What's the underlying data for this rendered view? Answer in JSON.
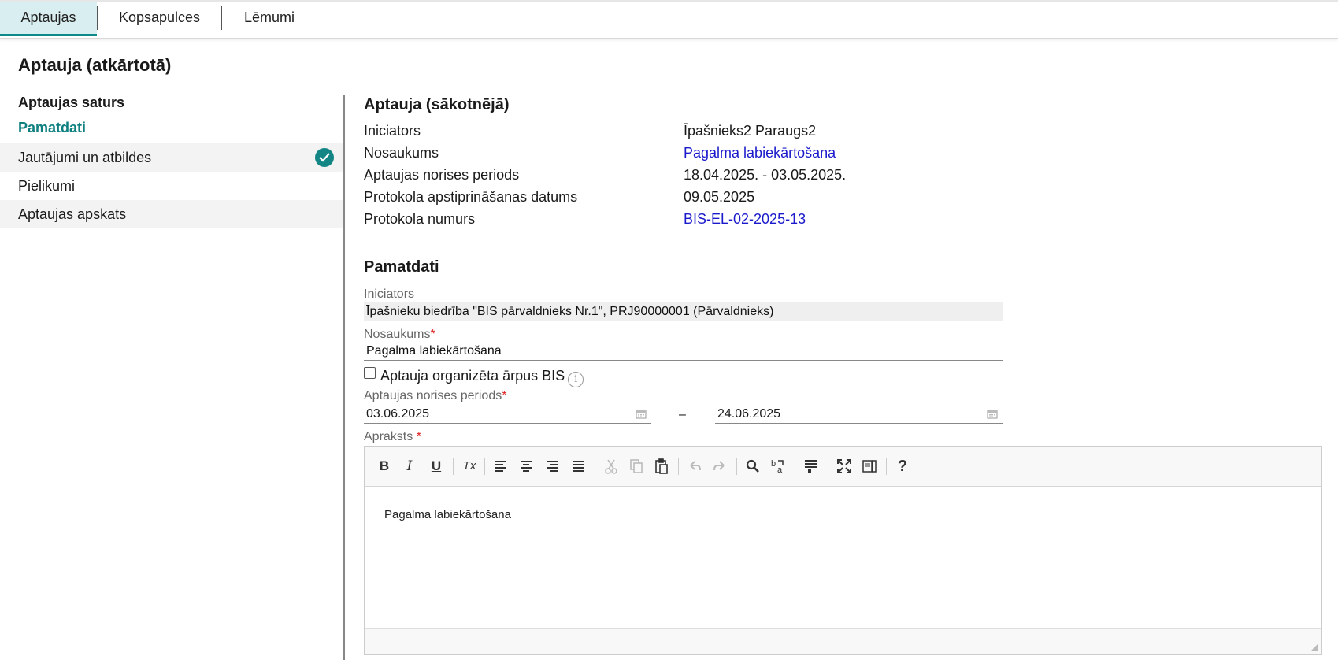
{
  "tabs": [
    "Aptaujas",
    "Kopsapulces",
    "Lēmumi"
  ],
  "page_title": "Aptauja (atkārtotā)",
  "sidebar": {
    "heading": "Aptaujas saturs",
    "items": [
      {
        "label": "Pamatdati"
      },
      {
        "label": "Jautājumi un atbildes"
      },
      {
        "label": "Pielikumi"
      },
      {
        "label": "Aptaujas apskats"
      }
    ]
  },
  "original": {
    "title": "Aptauja (sākotnējā)",
    "rows": [
      {
        "label": "Iniciators",
        "value": "Īpašnieks2 Paraugs2"
      },
      {
        "label": "Nosaukums",
        "value": "Pagalma labiekārtošana"
      },
      {
        "label": "Aptaujas norises periods",
        "value": "18.04.2025. - 03.05.2025."
      },
      {
        "label": "Protokola apstiprināšanas datums",
        "value": "09.05.2025"
      },
      {
        "label": "Protokola numurs",
        "value": "BIS-EL-02-2025-13"
      }
    ]
  },
  "basic": {
    "title": "Pamatdati",
    "initiator_label": "Iniciators",
    "initiator_value": "Īpašnieku biedrība \"BIS pārvaldnieks Nr.1\", PRJ90000001 (Pārvaldnieks)",
    "name_label": "Nosaukums",
    "name_value": "Pagalma labiekārtošana",
    "required_mark": "*",
    "outside_label": "Aptauja organizēta ārpus BIS",
    "info_glyph": "i",
    "period_label": "Aptaujas norises periods",
    "date_from": "03.06.2025",
    "date_to": "24.06.2025",
    "date_sep": "–",
    "desc_label": "Apraksts",
    "desc_required": " *",
    "desc_text": "Pagalma labiekārtošana"
  },
  "toolbar": {
    "bold": "B",
    "italic": "I",
    "underline": "U",
    "clear": "Tx",
    "help": "?"
  },
  "colors": {
    "accent": "#138585",
    "link": "#1a1acc",
    "active_tab": "#d9eef0"
  }
}
